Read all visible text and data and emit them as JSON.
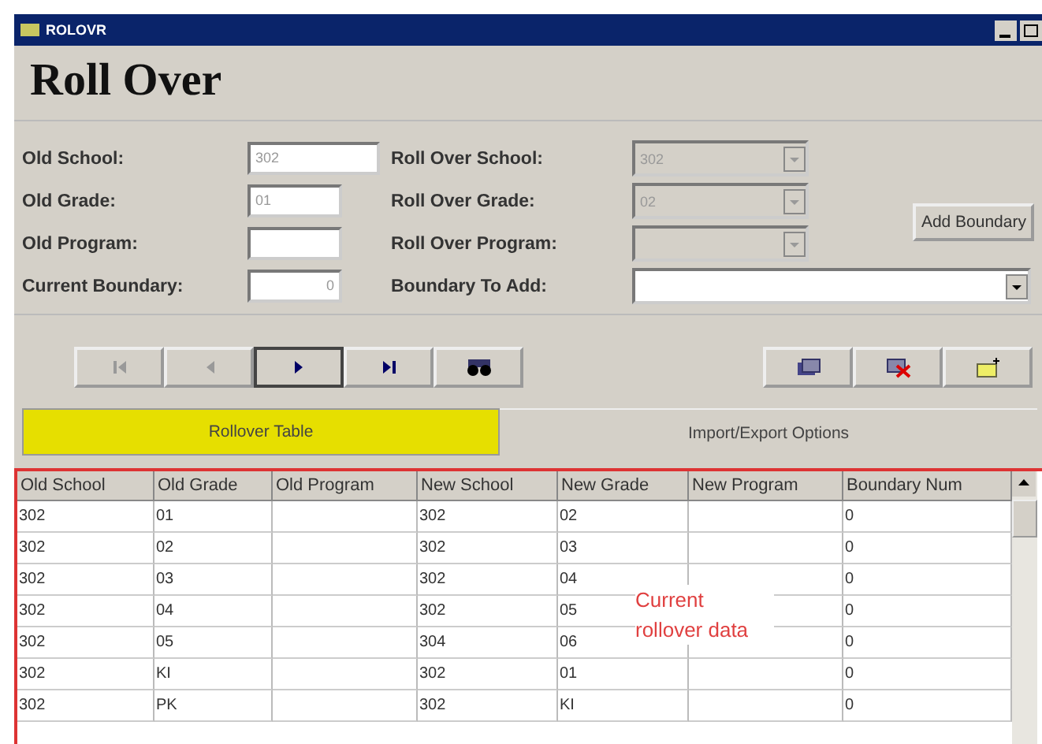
{
  "window": {
    "title": "ROLOVR"
  },
  "heading": "Roll Over",
  "left_fields": [
    {
      "label": "Old School:",
      "value": "302",
      "wide": true
    },
    {
      "label": "Old Grade:",
      "value": "01",
      "wide": false
    },
    {
      "label": "Old Program:",
      "wide": false
    },
    {
      "label": "Current Boundary:",
      "value": "0",
      "wide": false
    }
  ],
  "right_fields": [
    {
      "label": "Roll Over School:",
      "value": "302",
      "disabled": true
    },
    {
      "label": "Roll Over Grade:",
      "value": "02",
      "disabled": true
    },
    {
      "label": "Roll Over Program:",
      "disabled": true
    },
    {
      "label": "Boundary To Add:",
      "disabled": false
    }
  ],
  "add_boundary_button": "Add Boundary",
  "nav_buttons": [
    {
      "kind": "first",
      "disabled": true,
      "selected": false
    },
    {
      "kind": "prev",
      "disabled": true,
      "selected": false
    },
    {
      "kind": "next",
      "disabled": false,
      "selected": true
    },
    {
      "kind": "last",
      "disabled": false,
      "selected": false
    },
    {
      "kind": "find",
      "disabled": false,
      "selected": false
    }
  ],
  "record_buttons": [
    {
      "kind": "edit"
    },
    {
      "kind": "delete"
    },
    {
      "kind": "new"
    }
  ],
  "tabs": [
    {
      "label": "Rollover Table",
      "selected": true
    },
    {
      "label": "Import/Export Options",
      "selected": false
    }
  ],
  "table": {
    "columns": [
      "Old School",
      "Old Grade",
      "Old Program",
      "New School",
      "New Grade",
      "New Program",
      "Boundary Num"
    ],
    "rows": [
      [
        "302",
        "01",
        "",
        "302",
        "02",
        "",
        "0"
      ],
      [
        "302",
        "02",
        "",
        "302",
        "03",
        "",
        "0"
      ],
      [
        "302",
        "03",
        "",
        "302",
        "04",
        "",
        "0"
      ],
      [
        "302",
        "04",
        "",
        "302",
        "05",
        "",
        "0"
      ],
      [
        "302",
        "05",
        "",
        "304",
        "06",
        "",
        "0"
      ],
      [
        "302",
        "KI",
        "",
        "302",
        "01",
        "",
        "0"
      ],
      [
        "302",
        "PK",
        "",
        "302",
        "KI",
        "",
        "0"
      ]
    ]
  },
  "annotation": "Current rollover data"
}
